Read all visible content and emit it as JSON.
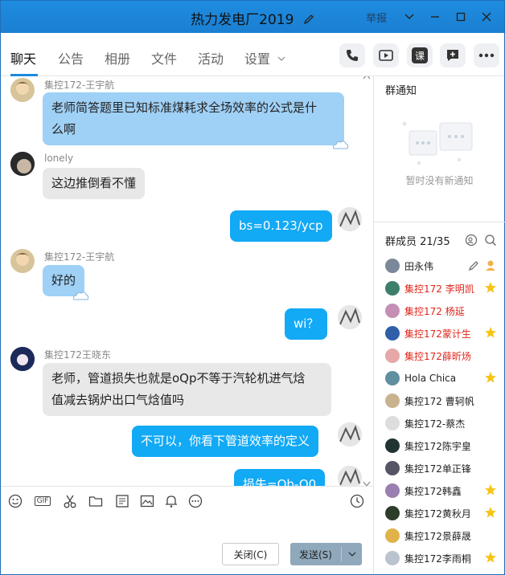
{
  "window": {
    "title": "热力发电厂2019",
    "report_label": "举报",
    "accent": "#1e8ae0"
  },
  "tabs": [
    {
      "label": "聊天",
      "active": true
    },
    {
      "label": "公告"
    },
    {
      "label": "相册"
    },
    {
      "label": "文件"
    },
    {
      "label": "活动"
    },
    {
      "label": "设置"
    }
  ],
  "header_actions": [
    "phone-icon",
    "video-icon",
    "course-icon",
    "chat-add-icon",
    "more-icon"
  ],
  "course_label": "课",
  "messages": [
    {
      "sender": "集控172-王宇航",
      "text_lines": [
        "老师简答题里已知标准煤耗求全场效率的公式是什",
        "么啊"
      ],
      "style": "blue"
    },
    {
      "sender": "lonely",
      "text_lines": [
        "这边推倒看不懂"
      ],
      "style": "gray"
    },
    {
      "sender": "",
      "text_lines": [
        "bs=0.123/ycp"
      ],
      "style": "me"
    },
    {
      "sender": "集控172-王宇航",
      "text_lines": [
        "好的"
      ],
      "style": "blue"
    },
    {
      "sender": "",
      "text_lines": [
        "wi？"
      ],
      "style": "me"
    },
    {
      "sender": "集控172王晓东",
      "text_lines": [
        "老师，管道损失也就是oQp不等于汽轮机进气焓",
        "值减去锅炉出口气焓值吗"
      ],
      "style": "gray"
    },
    {
      "sender": "",
      "text_lines": [
        "不可以，你看下管道效率的定义"
      ],
      "style": "me"
    },
    {
      "sender": "",
      "text_lines": [
        "损失=Qb-Q0"
      ],
      "style": "me"
    }
  ],
  "input_toolbar": [
    "emoji-icon",
    "gif-icon",
    "scissors-icon",
    "folder-icon",
    "doc-icon",
    "image-icon",
    "bell-icon",
    "more-circle-icon",
    "history-clock-icon"
  ],
  "gif_label": "GIF",
  "buttons": {
    "close": "关闭(C)",
    "send": "发送(S)"
  },
  "group_notice": {
    "title": "群通知",
    "empty_text": "暂时没有新通知"
  },
  "members": {
    "title": "群成员 21/35",
    "list": [
      {
        "name": "田永伟",
        "red": false,
        "badge": "owner"
      },
      {
        "name": "集控172 李明凯",
        "red": true,
        "badge": "star"
      },
      {
        "name": "集控172 杨延",
        "red": true,
        "badge": ""
      },
      {
        "name": "集控172蒙计生",
        "red": true,
        "badge": "star"
      },
      {
        "name": "集控172薛昕炀",
        "red": true,
        "badge": ""
      },
      {
        "name": "Hola Chica",
        "red": false,
        "badge": "star"
      },
      {
        "name": "集控172 曹轲帆",
        "red": false,
        "badge": ""
      },
      {
        "name": "集控172-蔡杰",
        "red": false,
        "badge": ""
      },
      {
        "name": "集控172陈宇皇",
        "red": false,
        "badge": ""
      },
      {
        "name": "集控172单正锋",
        "red": false,
        "badge": ""
      },
      {
        "name": "集控172韩鑫",
        "red": false,
        "badge": "star"
      },
      {
        "name": "集控172黄秋月",
        "red": false,
        "badge": "star"
      },
      {
        "name": "集控172景薛晟",
        "red": false,
        "badge": ""
      },
      {
        "name": "集控172李雨桐",
        "red": false,
        "badge": "star"
      }
    ]
  }
}
